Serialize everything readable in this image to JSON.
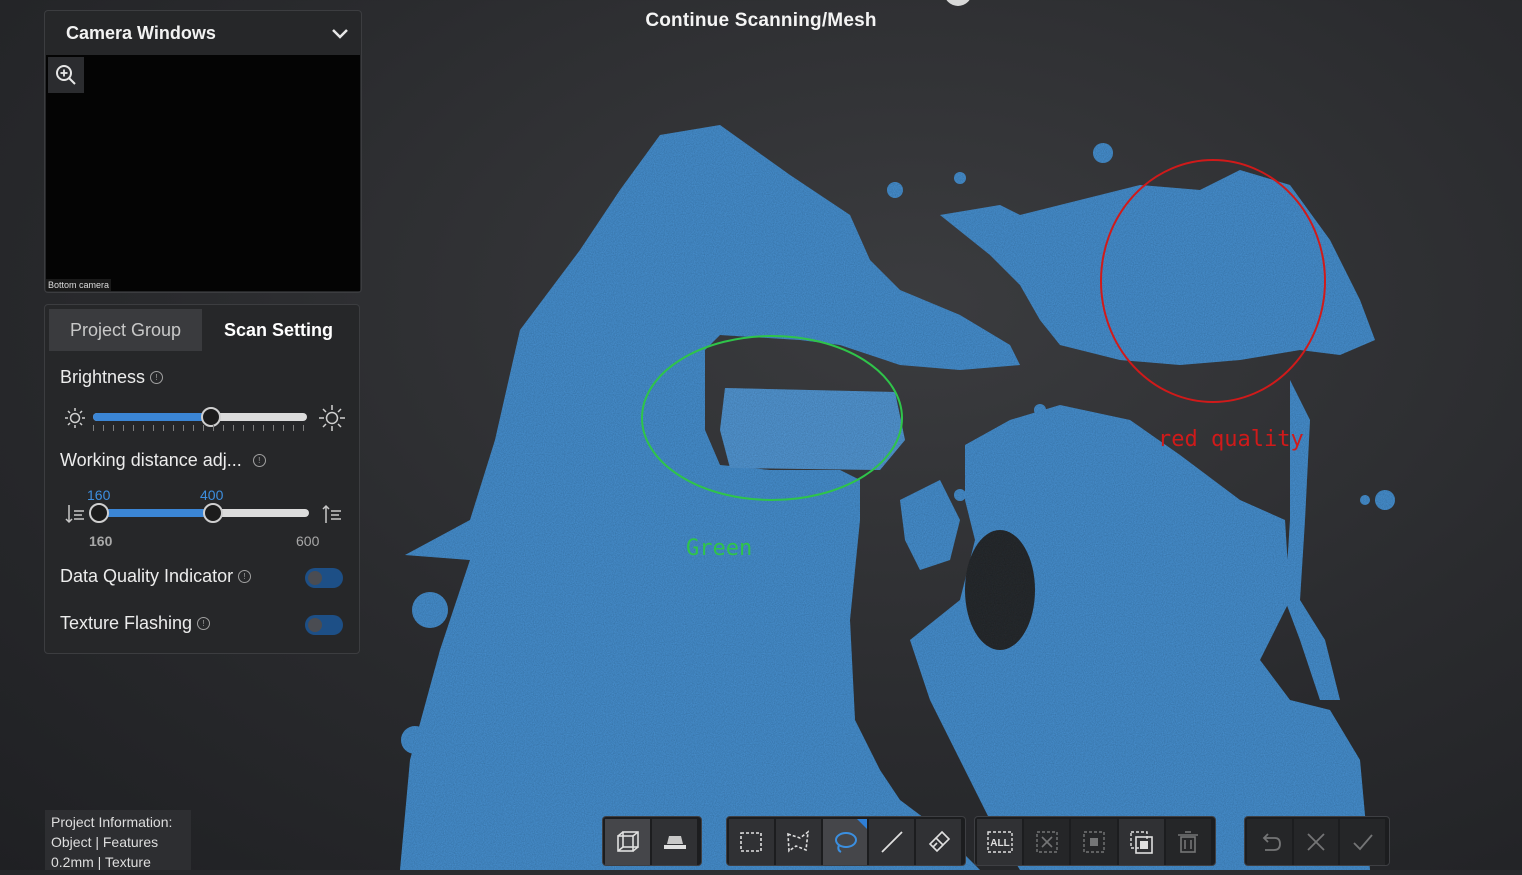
{
  "header": {
    "title": "Continue Scanning/Mesh"
  },
  "camera_panel": {
    "title": "Camera Windows",
    "label": "Bottom camera",
    "icons": [
      "zoom-in-icon",
      "chevron-down-icon"
    ]
  },
  "settings": {
    "tabs": [
      {
        "label": "Project Group",
        "active": false
      },
      {
        "label": "Scan Setting",
        "active": true
      }
    ],
    "brightness": {
      "label": "Brightness",
      "level_percent": 55
    },
    "working_distance": {
      "label": "Working distance adj...",
      "low_value": "160",
      "high_value": "400",
      "min_label": "160",
      "max_label": "600"
    },
    "data_quality": {
      "label": "Data Quality Indicator",
      "on": true
    },
    "texture_flashing": {
      "label": "Texture Flashing",
      "on": true
    }
  },
  "project_info": {
    "line1": "Project Information:",
    "line2": "Object | Features",
    "line3": "0.2mm | Texture"
  },
  "annotations": {
    "green_label": "Green",
    "red_label": "red quality",
    "green_color": "#2fc44a",
    "red_color": "#d01a1a"
  },
  "colors": {
    "mesh": "#4a92d2",
    "accent": "#3b86d6"
  },
  "toolbar": {
    "groups": [
      [
        "view-cube-icon",
        "base-plane-icon"
      ],
      [
        "rectangle-select-icon",
        "polygon-select-icon",
        "lasso-select-icon",
        "line-select-icon",
        "brush-select-icon"
      ],
      [
        "select-all-icon",
        "deselect-icon",
        "invert-select-icon",
        "select-connected-icon",
        "delete-icon"
      ],
      [
        "undo-icon",
        "cancel-icon",
        "confirm-icon"
      ]
    ],
    "select_all_text": "ALL"
  }
}
